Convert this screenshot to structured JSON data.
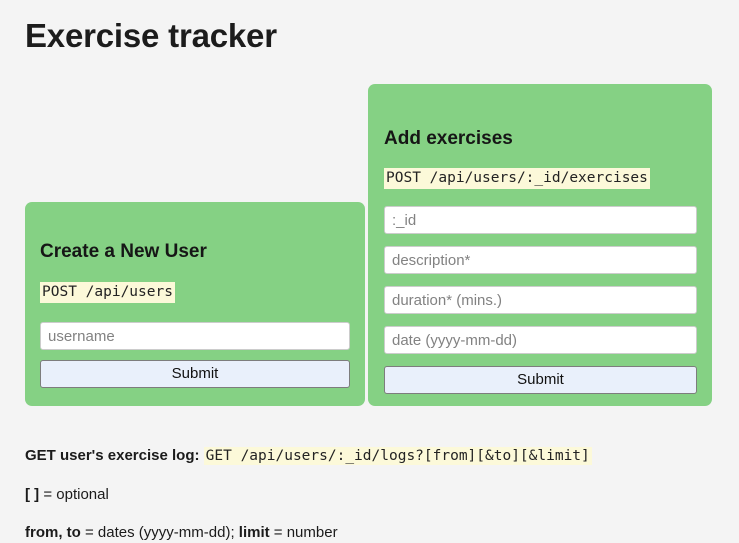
{
  "page": {
    "title": "Exercise tracker",
    "background_color": "#f4f4f4",
    "card_color": "#85d184",
    "code_highlight_color": "#fcf9d9",
    "button_color": "#e9f0fb"
  },
  "create_user_card": {
    "heading": "Create a New User",
    "endpoint": "POST /api/users",
    "username_placeholder": "username",
    "username_value": "",
    "submit_label": "Submit"
  },
  "add_exercises_card": {
    "heading": "Add exercises",
    "endpoint": "POST /api/users/:_id/exercises",
    "id_placeholder": ":_id",
    "id_value": "",
    "description_placeholder": "description*",
    "description_value": "",
    "duration_placeholder": "duration* (mins.)",
    "duration_value": "",
    "date_placeholder": "date (yyyy-mm-dd)",
    "date_value": "",
    "submit_label": "Submit"
  },
  "notes": {
    "log_label": "GET user's exercise log:",
    "log_endpoint": "GET /api/users/:_id/logs?[from][&to][&limit]",
    "optional_symbol": "[ ]",
    "optional_text": " = optional",
    "params_bold_1": "from, to",
    "params_mid": " = dates (yyyy-mm-dd); ",
    "params_bold_2": "limit",
    "params_end": " = number"
  }
}
